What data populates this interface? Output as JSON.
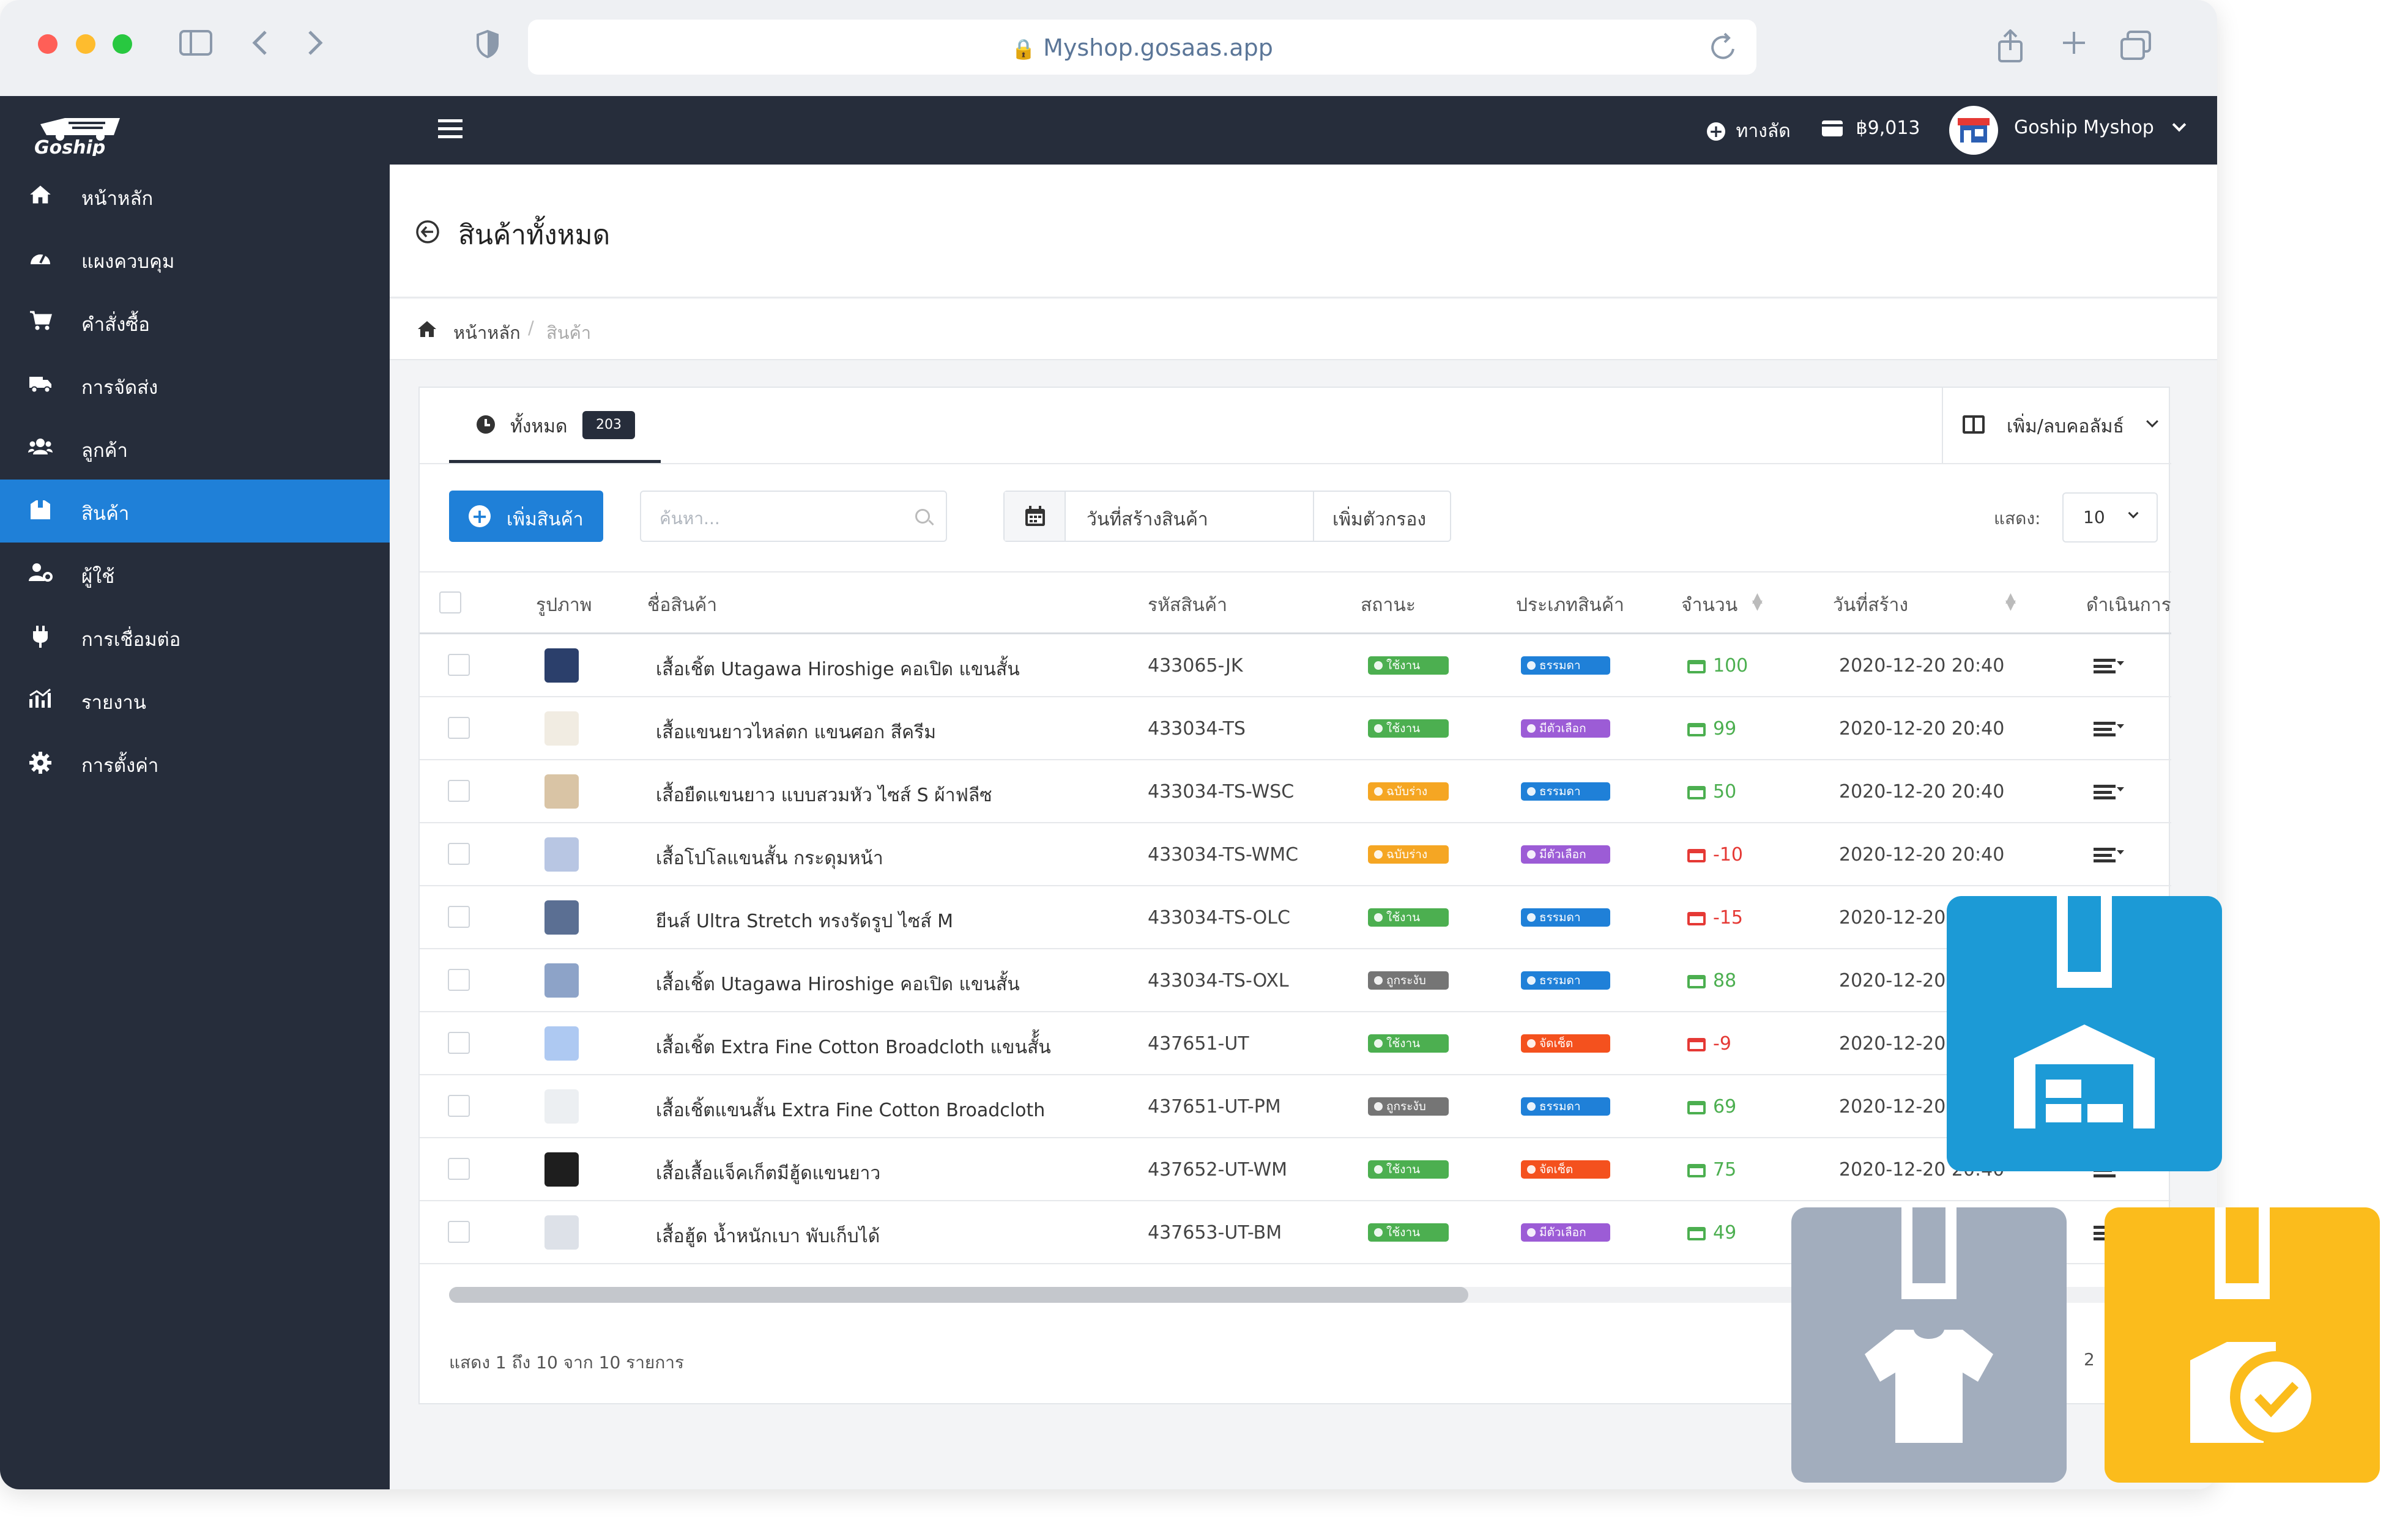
{
  "browser": {
    "url": "Myshop.gosaas.app"
  },
  "brand": {
    "name": "Goship"
  },
  "topbar": {
    "shortcut_label": "ทางลัด",
    "balance": "฿9,013",
    "user_name": "Goship Myshop"
  },
  "sidebar": {
    "items": [
      {
        "label": "หน้าหลัก",
        "icon": "home-icon"
      },
      {
        "label": "แผงควบคุม",
        "icon": "dashboard-icon"
      },
      {
        "label": "คำสั่งซื้อ",
        "icon": "cart-icon"
      },
      {
        "label": "การจัดส่ง",
        "icon": "truck-icon"
      },
      {
        "label": "ลูกค้า",
        "icon": "users-icon"
      },
      {
        "label": "สินค้า",
        "icon": "box-icon"
      },
      {
        "label": "ผู้ใช้",
        "icon": "user-gear-icon"
      },
      {
        "label": "การเชื่อมต่อ",
        "icon": "plug-icon"
      },
      {
        "label": "รายงาน",
        "icon": "chart-icon"
      },
      {
        "label": "การตั้งค่า",
        "icon": "gear-icon"
      }
    ],
    "active_index": 5
  },
  "page": {
    "title": "สินค้าทั้งหมด",
    "breadcrumb_home": "หน้าหลัก",
    "breadcrumb_current": "สินค้า"
  },
  "tabs": {
    "all_label": "ทั้งหมด",
    "all_count": "203",
    "columns_button": "เพิ่ม/ลบคอลัมธ์"
  },
  "toolbar": {
    "add_button": "เพิ่มสินค้า",
    "search_placeholder": "ค้นหา...",
    "date_filter": "วันที่สร้างสินค้า",
    "add_filter": "เพิ่มตัวกรอง",
    "show_label": "แสดง:",
    "page_size": "10"
  },
  "table": {
    "headers": [
      "รูปภาพ",
      "ชื่อสินค้า",
      "รหัสสินค้า",
      "สถานะ",
      "ประเภทสินค้า",
      "จำนวน",
      "วันที่สร้าง",
      "ดำเนินการ"
    ],
    "rows": [
      {
        "name": "เสื้อเชิ้ต Utagawa Hiroshige คอเปิด แขนสั้น",
        "sku": "433065-JK",
        "status": "ใช้งาน",
        "status_color": "#4caf50",
        "type": "ธรรมดา",
        "type_color": "#1f80d8",
        "qty": "100",
        "qty_color": "#4caf50",
        "date": "2020-12-20 20:40",
        "thumb_color": "#2b3f6b"
      },
      {
        "name": "เสื้อแขนยาวไหล่ตก แขนศอก สีครีม",
        "sku": "433034-TS",
        "status": "ใช้งาน",
        "status_color": "#4caf50",
        "type": "มีตัวเลือก",
        "type_color": "#9c5cd6",
        "qty": "99",
        "qty_color": "#4caf50",
        "date": "2020-12-20 20:40",
        "thumb_color": "#f1ece2"
      },
      {
        "name": "เสื้อยืดแขนยาว แบบสวมหัว ไซส์ S ผ้าฟลีซ",
        "sku": "433034-TS-WSC",
        "status": "ฉบับร่าง",
        "status_color": "#f5a623",
        "type": "ธรรมดา",
        "type_color": "#1f80d8",
        "qty": "50",
        "qty_color": "#4caf50",
        "date": "2020-12-20 20:40",
        "thumb_color": "#d9c4a5"
      },
      {
        "name": "เสื้อโปโลแขนสั้น กระดุมหน้า",
        "sku": "433034-TS-WMC",
        "status": "ฉบับร่าง",
        "status_color": "#f5a623",
        "type": "มีตัวเลือก",
        "type_color": "#9c5cd6",
        "qty": "-10",
        "qty_color": "#e53935",
        "date": "2020-12-20 20:40",
        "thumb_color": "#b8c6e3"
      },
      {
        "name": "ยีนส์ Ultra Stretch ทรงรัดรูป ไซส์ M",
        "sku": "433034-TS-OLC",
        "status": "ใช้งาน",
        "status_color": "#4caf50",
        "type": "ธรรมดา",
        "type_color": "#1f80d8",
        "qty": "-15",
        "qty_color": "#e53935",
        "date": "2020-12-20 20:40",
        "thumb_color": "#5b6f93"
      },
      {
        "name": "เสื้อเชิ้ต Utagawa Hiroshige คอเปิด แขนสั้น",
        "sku": "433034-TS-OXL",
        "status": "ถูกระงับ",
        "status_color": "#757575",
        "type": "ธรรมดา",
        "type_color": "#1f80d8",
        "qty": "88",
        "qty_color": "#4caf50",
        "date": "2020-12-20 20:40",
        "thumb_color": "#8da3c8"
      },
      {
        "name": "เสื้อเชิ้ต Extra Fine Cotton Broadcloth แขนสั้้น",
        "sku": "437651-UT",
        "status": "ใช้งาน",
        "status_color": "#4caf50",
        "type": "จัดเซ็ต",
        "type_color": "#f4511e",
        "qty": "-9",
        "qty_color": "#e53935",
        "date": "2020-12-20 20:40",
        "thumb_color": "#aec9f2"
      },
      {
        "name": "เสื้อเชิ้ตแขนสั้น Extra Fine Cotton Broadcloth",
        "sku": "437651-UT-PM",
        "status": "ถูกระงับ",
        "status_color": "#757575",
        "type": "ธรรมดา",
        "type_color": "#1f80d8",
        "qty": "69",
        "qty_color": "#4caf50",
        "date": "2020-12-20 20:40",
        "thumb_color": "#eceff2"
      },
      {
        "name": "เสื้อเสื้อแจ็คเก็ตมีฮู้ดแขนยาว",
        "sku": "437652-UT-WM",
        "status": "ใช้งาน",
        "status_color": "#4caf50",
        "type": "จัดเซ็ต",
        "type_color": "#f4511e",
        "qty": "75",
        "qty_color": "#4caf50",
        "date": "2020-12-20 20:40",
        "thumb_color": "#1e1e1e"
      },
      {
        "name": "เสื้อฮู้ด น้ำหนักเบา พับเก็บได้",
        "sku": "437653-UT-BM",
        "status": "ใช้งาน",
        "status_color": "#4caf50",
        "type": "มีตัวเลือก",
        "type_color": "#9c5cd6",
        "qty": "49",
        "qty_color": "#4caf50",
        "date": "2020-12-20 20:40",
        "thumb_color": "#dde1e8"
      }
    ]
  },
  "footer": {
    "summary": "แสดง 1 ถึง 10 จาก 10 รายการ",
    "page_number": "2"
  },
  "overlay": {
    "warehouse_color": "#1c9ad6",
    "apparel_color": "#a2adbd",
    "stock_color": "#fbbc1c"
  },
  "colors": {
    "sidebar_bg": "#262d3b",
    "accent": "#1f80d8"
  }
}
